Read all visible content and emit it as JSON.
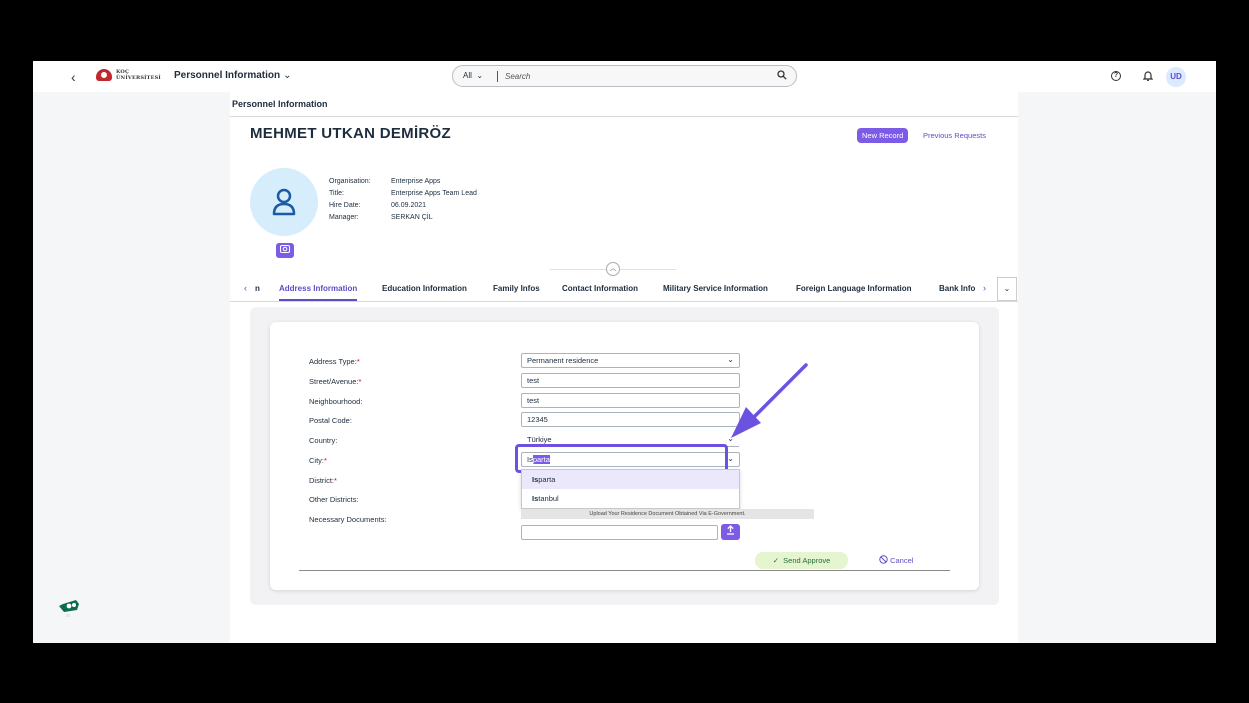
{
  "shell": {
    "back_label": "‹",
    "logo_line1": "KOÇ",
    "logo_line2": "ÜNİVERSİTESİ",
    "app_title": "Personnel Information",
    "search_scope": "All",
    "search_placeholder": "Search",
    "user_initials": "UD"
  },
  "breadcrumb": "Personnel Information",
  "person": {
    "name": "MEHMET UTKAN DEMİRÖZ",
    "info": [
      {
        "label": "Organisation:",
        "value": "Enterprise Apps"
      },
      {
        "label": "Title:",
        "value": "Enterprise Apps Team Lead"
      },
      {
        "label": "Hire Date:",
        "value": "06.09.2021"
      },
      {
        "label": "Manager:",
        "value": "SERKAN ÇİL"
      }
    ]
  },
  "header_actions": {
    "new_record": "New Record",
    "previous_requests": "Previous Requests"
  },
  "tabs": [
    {
      "label": "n",
      "active": false
    },
    {
      "label": "Address Information",
      "active": true
    },
    {
      "label": "Education Information",
      "active": false
    },
    {
      "label": "Family Infos",
      "active": false
    },
    {
      "label": "Contact Information",
      "active": false
    },
    {
      "label": "Military Service Information",
      "active": false
    },
    {
      "label": "Foreign Language Information",
      "active": false
    },
    {
      "label": "Bank Info",
      "active": false
    }
  ],
  "form": {
    "fields": [
      {
        "label": "Address Type:",
        "required": true,
        "value": "Permanent residence"
      },
      {
        "label": "Street/Avenue:",
        "required": true,
        "value": "test"
      },
      {
        "label": "Neighbourhood:",
        "required": false,
        "value": "test"
      },
      {
        "label": "Postal Code:",
        "required": false,
        "value": "12345"
      },
      {
        "label": "Country:",
        "required": false,
        "value": "Türkiye"
      },
      {
        "label": "City:",
        "required": true,
        "value": "Isparta"
      },
      {
        "label": "District:",
        "required": true,
        "value": ""
      },
      {
        "label": "Other Districts:",
        "required": false,
        "value": ""
      },
      {
        "label": "Necessary Documents:",
        "required": false,
        "value": ""
      }
    ],
    "city_typed": "Is",
    "city_autocomplete": "parta",
    "suggestions": [
      {
        "match": "Is",
        "rest": "parta"
      },
      {
        "match": "Is",
        "rest": "tanbul"
      }
    ],
    "upload_note": "Upload Your Residence Document Obtained Via E-Government.",
    "send_approve": "Send Approve",
    "cancel": "Cancel"
  },
  "colors": {
    "accent": "#7c5ce6",
    "annotation": "#6d52e2",
    "required": "#d0021b"
  }
}
